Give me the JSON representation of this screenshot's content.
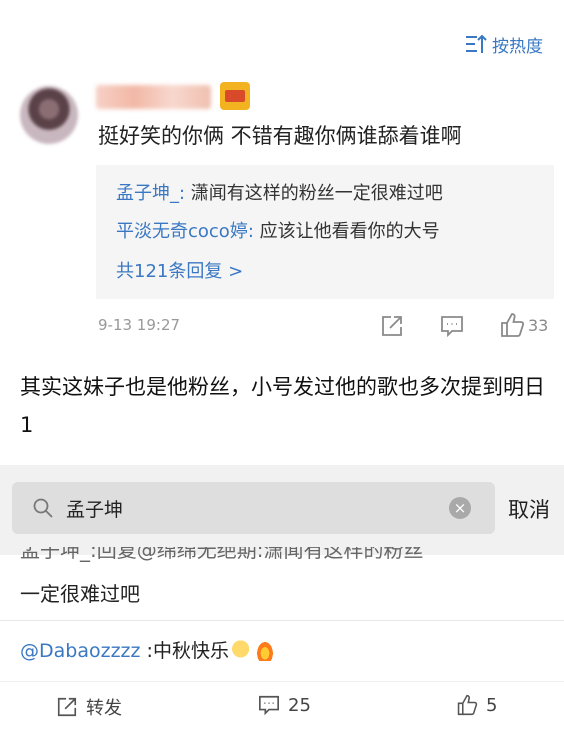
{
  "sort": {
    "label": "按热度"
  },
  "comment": {
    "text": "挺好笑的你俩 不错有趣你俩谁舔着谁啊",
    "time": "9-13 19:27",
    "like_count": "33",
    "replies": [
      {
        "user": "孟子坤_:",
        "text": " 潇闻有这样的粉丝一定很难过吧"
      },
      {
        "user": "平淡无奇coco婷:",
        "text": " 应该让他看看你的大号"
      }
    ],
    "more_replies": "共121条回复 >"
  },
  "paragraph": "其实这妹子也是他粉丝，小号发过他的歌也多次提到明日1",
  "search": {
    "value": "孟子坤",
    "cancel_label": "取消"
  },
  "partial": {
    "clipped_text": "孟子坤_:回复@绵绵无绝期:潇闻有这样的粉丝",
    "continuation": "一定很难过吧"
  },
  "mention": {
    "user": "@Dabaozzzz",
    "text": " :中秋快乐"
  },
  "bottom_bar": {
    "repost_label": "转发",
    "comment_count": "25",
    "like_count": "5"
  },
  "colors": {
    "link": "#3a78c3",
    "reply_bg": "#f5f5f5",
    "search_bg": "#dedede"
  }
}
